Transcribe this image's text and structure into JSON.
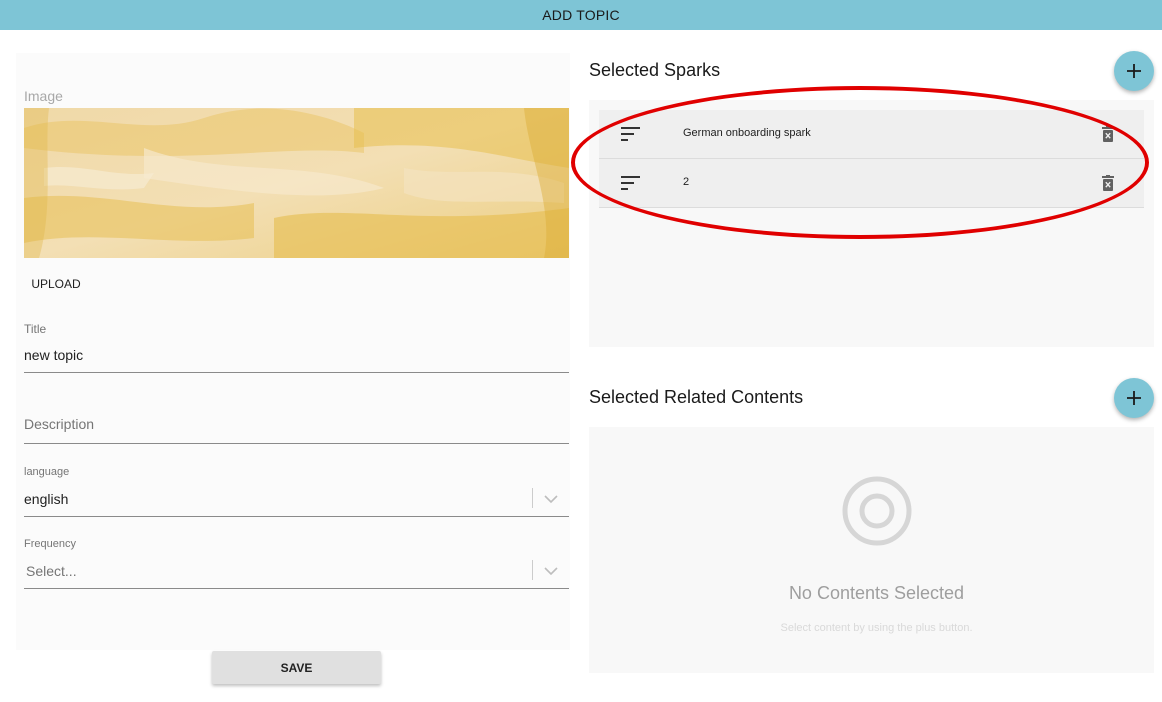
{
  "header": {
    "title": "ADD TOPIC"
  },
  "form": {
    "image_label": "Image",
    "upload_label": "UPLOAD",
    "title_label": "Title",
    "title_value": "new topic",
    "description_placeholder": "Description",
    "language_label": "language",
    "language_value": "english",
    "frequency_label": "Frequency",
    "frequency_placeholder": "Select...",
    "save_label": "SAVE"
  },
  "sparks": {
    "heading": "Selected Sparks",
    "items": [
      {
        "title": "German onboarding spark"
      },
      {
        "title": "2"
      }
    ]
  },
  "related": {
    "heading": "Selected Related Contents",
    "empty_title": "No Contents Selected",
    "empty_subtitle": "Select content by using the plus button."
  },
  "colors": {
    "accent": "#7ec5d6",
    "highlight": "#e00000"
  }
}
